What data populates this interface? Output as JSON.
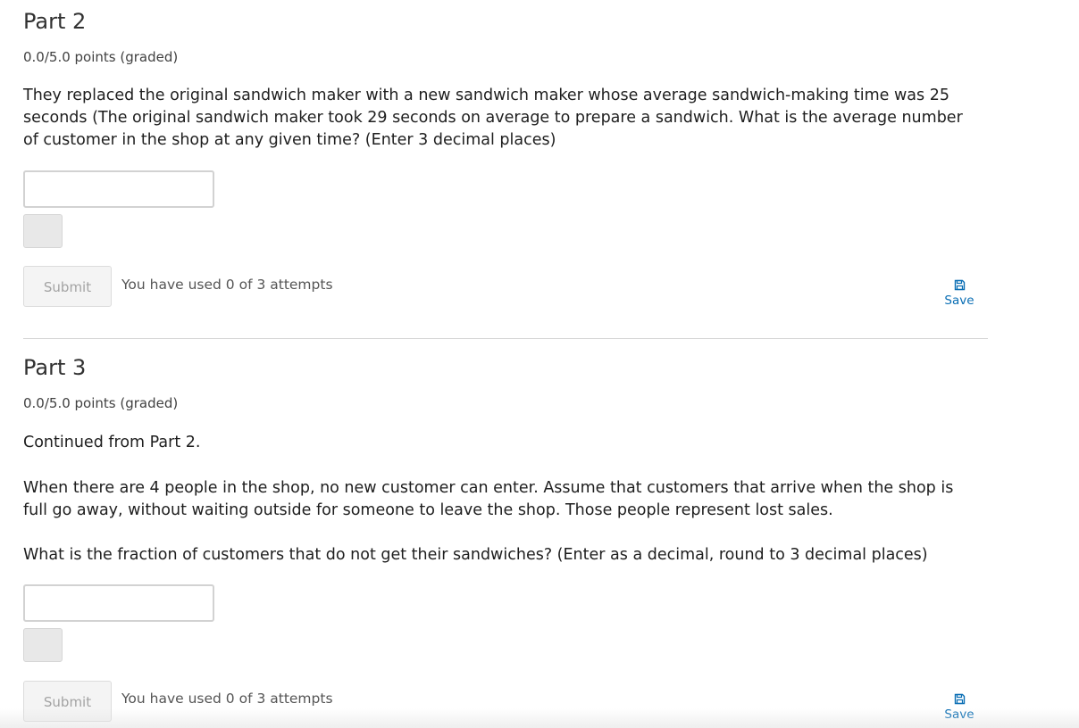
{
  "parts": [
    {
      "title": "Part 2",
      "points": "0.0/5.0 points (graded)",
      "paragraphs": [
        "They replaced the original sandwich maker with a new sandwich maker whose average sandwich-making time was 25 seconds (The original sandwich maker took 29 seconds on average to prepare a sandwich. What is the average number of customer in the shop at any given time? (Enter 3 decimal places)"
      ],
      "answer_value": "",
      "submit_label": "Submit",
      "attempts_text": "You have used 0 of 3 attempts",
      "save_label": "Save",
      "save_icon": "floppy-disk-icon"
    },
    {
      "title": "Part 3",
      "points": "0.0/5.0 points (graded)",
      "paragraphs": [
        "Continued from Part 2.",
        "When there are 4 people in the shop, no new customer can enter. Assume that customers that arrive when the shop is full go away, without waiting outside for someone to leave the shop. Those people represent lost sales.",
        "What is the fraction of customers that do not get their sandwiches? (Enter as a decimal, round to 3 decimal places)"
      ],
      "answer_value": "",
      "submit_label": "Submit",
      "attempts_text": "You have used 0 of 3 attempts",
      "save_label": "Save",
      "save_icon": "floppy-disk-icon"
    }
  ],
  "colors": {
    "link": "#0a6eb4",
    "text": "#313131",
    "divider": "#d4d4d4",
    "submit_disabled_text": "#a3a3a3"
  }
}
